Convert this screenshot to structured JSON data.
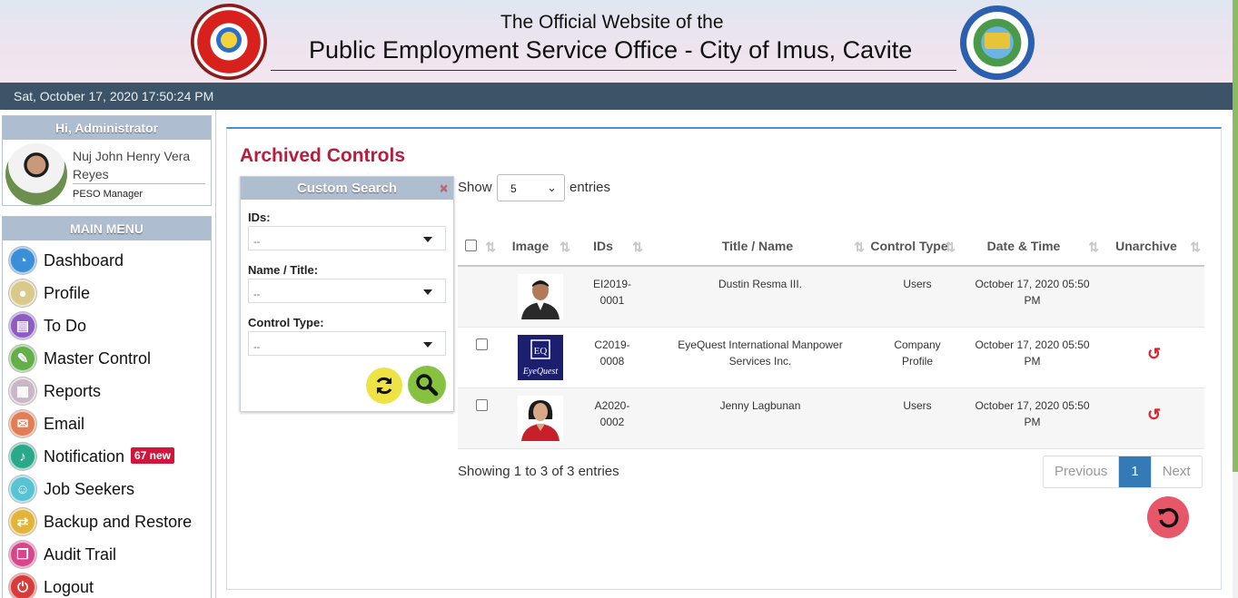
{
  "header": {
    "subtitle": "The Official Website of the",
    "title": "Public Employment Service Office - City of Imus, Cavite"
  },
  "datetime": "Sat, October 17, 2020 17:50:24 PM",
  "user": {
    "greeting": "Hi, Administrator",
    "name": "Nuj John Henry Vera Reyes",
    "role": "PESO Manager"
  },
  "menu": {
    "title": "MAIN MENU",
    "items": [
      {
        "label": "Dashboard",
        "icon": "dashboard-icon",
        "color": "#3b8fd6"
      },
      {
        "label": "Profile",
        "icon": "profile-icon",
        "color": "#d9c98a"
      },
      {
        "label": "To Do",
        "icon": "todo-icon",
        "color": "#8c5cc4"
      },
      {
        "label": "Master Control",
        "icon": "wrench-icon",
        "color": "#63b04a"
      },
      {
        "label": "Reports",
        "icon": "reports-icon",
        "color": "#c9b6c6"
      },
      {
        "label": "Email",
        "icon": "email-icon",
        "color": "#e27d56"
      },
      {
        "label": "Notification",
        "icon": "bell-icon",
        "color": "#2aa98a",
        "badge": "67 new"
      },
      {
        "label": "Job Seekers",
        "icon": "jobseekers-icon",
        "color": "#58c3d3"
      },
      {
        "label": "Backup and Restore",
        "icon": "backup-icon",
        "color": "#e3b43a"
      },
      {
        "label": "Audit Trail",
        "icon": "audit-icon",
        "color": "#d8458c"
      },
      {
        "label": "Logout",
        "icon": "power-icon",
        "color": "#d93a3a"
      }
    ]
  },
  "main": {
    "title": "Archived Controls",
    "search": {
      "title": "Custom Search",
      "close": "×",
      "fields": [
        {
          "label": "IDs:",
          "value": "--"
        },
        {
          "label": "Name / Title:",
          "value": "--"
        },
        {
          "label": "Control Type:",
          "value": "--"
        }
      ]
    },
    "show_label": "Show",
    "show_value": "5",
    "entries_label": "entries",
    "columns": [
      "Image",
      "IDs",
      "Title / Name",
      "Control Type",
      "Date & Time",
      "Unarchive"
    ],
    "rows": [
      {
        "id": "EI2019-0001",
        "title": "Dustin Resma III.",
        "type": "Users",
        "date": "October 17, 2020 05:50 PM",
        "checkbox": false,
        "unarchive": false,
        "thumb": "male-photo"
      },
      {
        "id": "C2019-0008",
        "title": "EyeQuest International Manpower Services Inc.",
        "type": "Company Profile",
        "date": "October 17, 2020 05:50 PM",
        "checkbox": true,
        "unarchive": true,
        "thumb": "eyequest-logo",
        "logo_text": "EyeQuest",
        "logo_mark": "EQ"
      },
      {
        "id": "A2020-0002",
        "title": "Jenny Lagbunan",
        "type": "Users",
        "date": "October 17, 2020 05:50 PM",
        "checkbox": true,
        "unarchive": true,
        "thumb": "female-photo"
      }
    ],
    "info": "Showing 1 to 3 of 3 entries",
    "pagination": {
      "previous": "Previous",
      "current": "1",
      "next": "Next"
    }
  }
}
